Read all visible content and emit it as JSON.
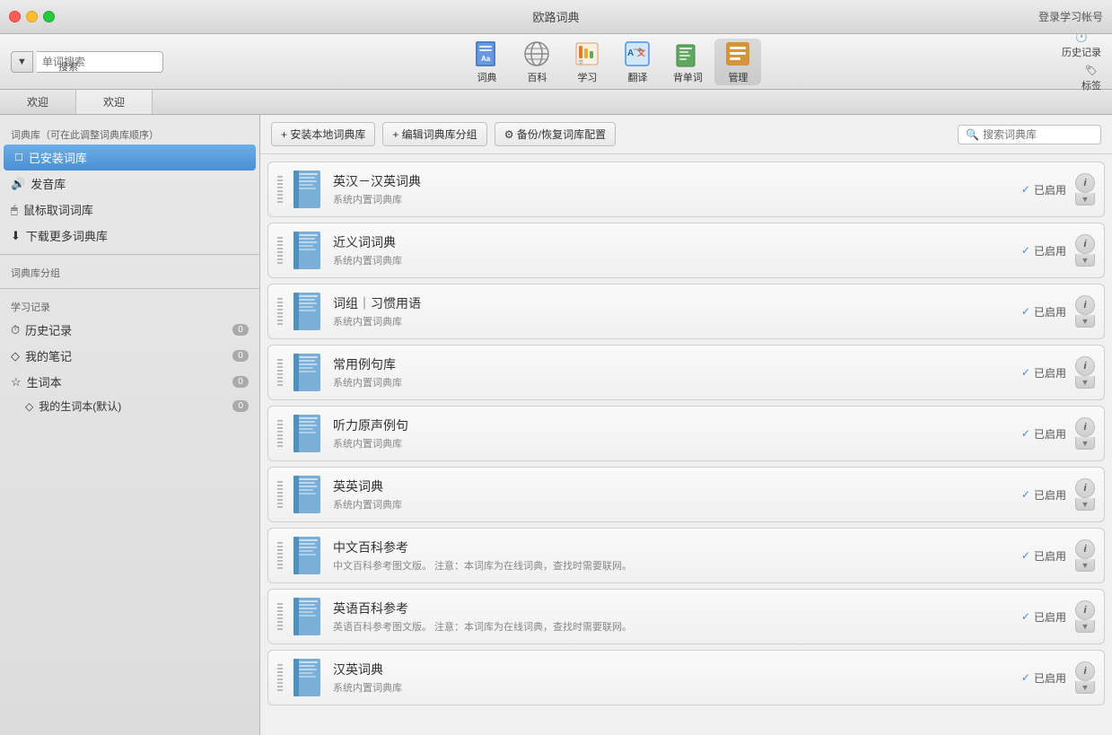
{
  "app": {
    "title": "欧路词典",
    "account": "登录学习帐号"
  },
  "toolbar": {
    "search_placeholder": "单词搜索",
    "search_label": "搜索",
    "buttons": [
      {
        "id": "dict",
        "label": "词典",
        "icon": "📖"
      },
      {
        "id": "wiki",
        "label": "百科",
        "icon": "🌐"
      },
      {
        "id": "learn",
        "label": "学习",
        "icon": "📊"
      },
      {
        "id": "translate",
        "label": "翻译",
        "icon": "🔤"
      },
      {
        "id": "background",
        "label": "背单词",
        "icon": "🃏"
      },
      {
        "id": "manage",
        "label": "管理",
        "icon": "📋"
      }
    ],
    "history_label": "历史记录",
    "tags_label": "标签"
  },
  "tabs": [
    {
      "id": "welcome1",
      "label": "欢迎"
    },
    {
      "id": "welcome2",
      "label": "欢迎"
    }
  ],
  "sidebar": {
    "dict_library_title": "词典库（可在此调整词典库顺序）",
    "items": [
      {
        "id": "installed",
        "label": "已安装词库",
        "icon": "☐",
        "indent": 0,
        "selected": true
      },
      {
        "id": "pronunciation",
        "label": "发音库",
        "icon": "○",
        "indent": 0
      },
      {
        "id": "mouse",
        "label": "鼠标取词词库",
        "icon": "○",
        "indent": 0
      },
      {
        "id": "download",
        "label": "下载更多词典库",
        "icon": "↓",
        "indent": 0
      }
    ],
    "dict_group_title": "词典库分组",
    "study_title": "学习记录",
    "study_items": [
      {
        "id": "history",
        "label": "历史记录",
        "icon": "○",
        "badge": "0"
      },
      {
        "id": "notes",
        "label": "我的笔记",
        "icon": "◇",
        "badge": "0"
      },
      {
        "id": "vocab",
        "label": "生词本",
        "icon": "☆",
        "badge": "0"
      }
    ],
    "sub_items": [
      {
        "id": "my-vocab",
        "label": "我的生词本(默认)",
        "icon": "◇",
        "badge": "0"
      }
    ]
  },
  "action_bar": {
    "install_local": "+ 安装本地词典库",
    "edit_group": "+ 编辑词典库分组",
    "backup": "⚙ 备份/恢复词库配置",
    "search_placeholder": "搜索词典库"
  },
  "dictionaries": [
    {
      "id": "zh-en",
      "name": "英汉－汉英词典",
      "sub": "系统内置词典库",
      "enabled": true,
      "status": "已启用"
    },
    {
      "id": "synonyms",
      "name": "近义词词典",
      "sub": "系统内置词典库",
      "enabled": true,
      "status": "已启用"
    },
    {
      "id": "phrases",
      "name": "词组｜习惯用语",
      "sub": "系统内置词典库",
      "enabled": true,
      "status": "已启用"
    },
    {
      "id": "sentences",
      "name": "常用例句库",
      "sub": "系统内置词典库",
      "enabled": true,
      "status": "已启用"
    },
    {
      "id": "audio",
      "name": "听力原声例句",
      "sub": "系统内置词典库",
      "enabled": true,
      "status": "已启用"
    },
    {
      "id": "en",
      "name": "英英词典",
      "sub": "系统内置词典库",
      "enabled": true,
      "status": "已启用"
    },
    {
      "id": "cn-wiki",
      "name": "中文百科参考",
      "sub": "中文百科参考图文版。 注意：本词库为在线词典，查找时需要联网。",
      "enabled": true,
      "status": "已启用"
    },
    {
      "id": "en-wiki",
      "name": "英语百科参考",
      "sub": "英语百科参考图文版。 注意：本词库为在线词典，查找时需要联网。",
      "enabled": true,
      "status": "已启用"
    },
    {
      "id": "en-zh",
      "name": "汉英词典",
      "sub": "系统内置词典库",
      "enabled": true,
      "status": "已启用"
    }
  ]
}
